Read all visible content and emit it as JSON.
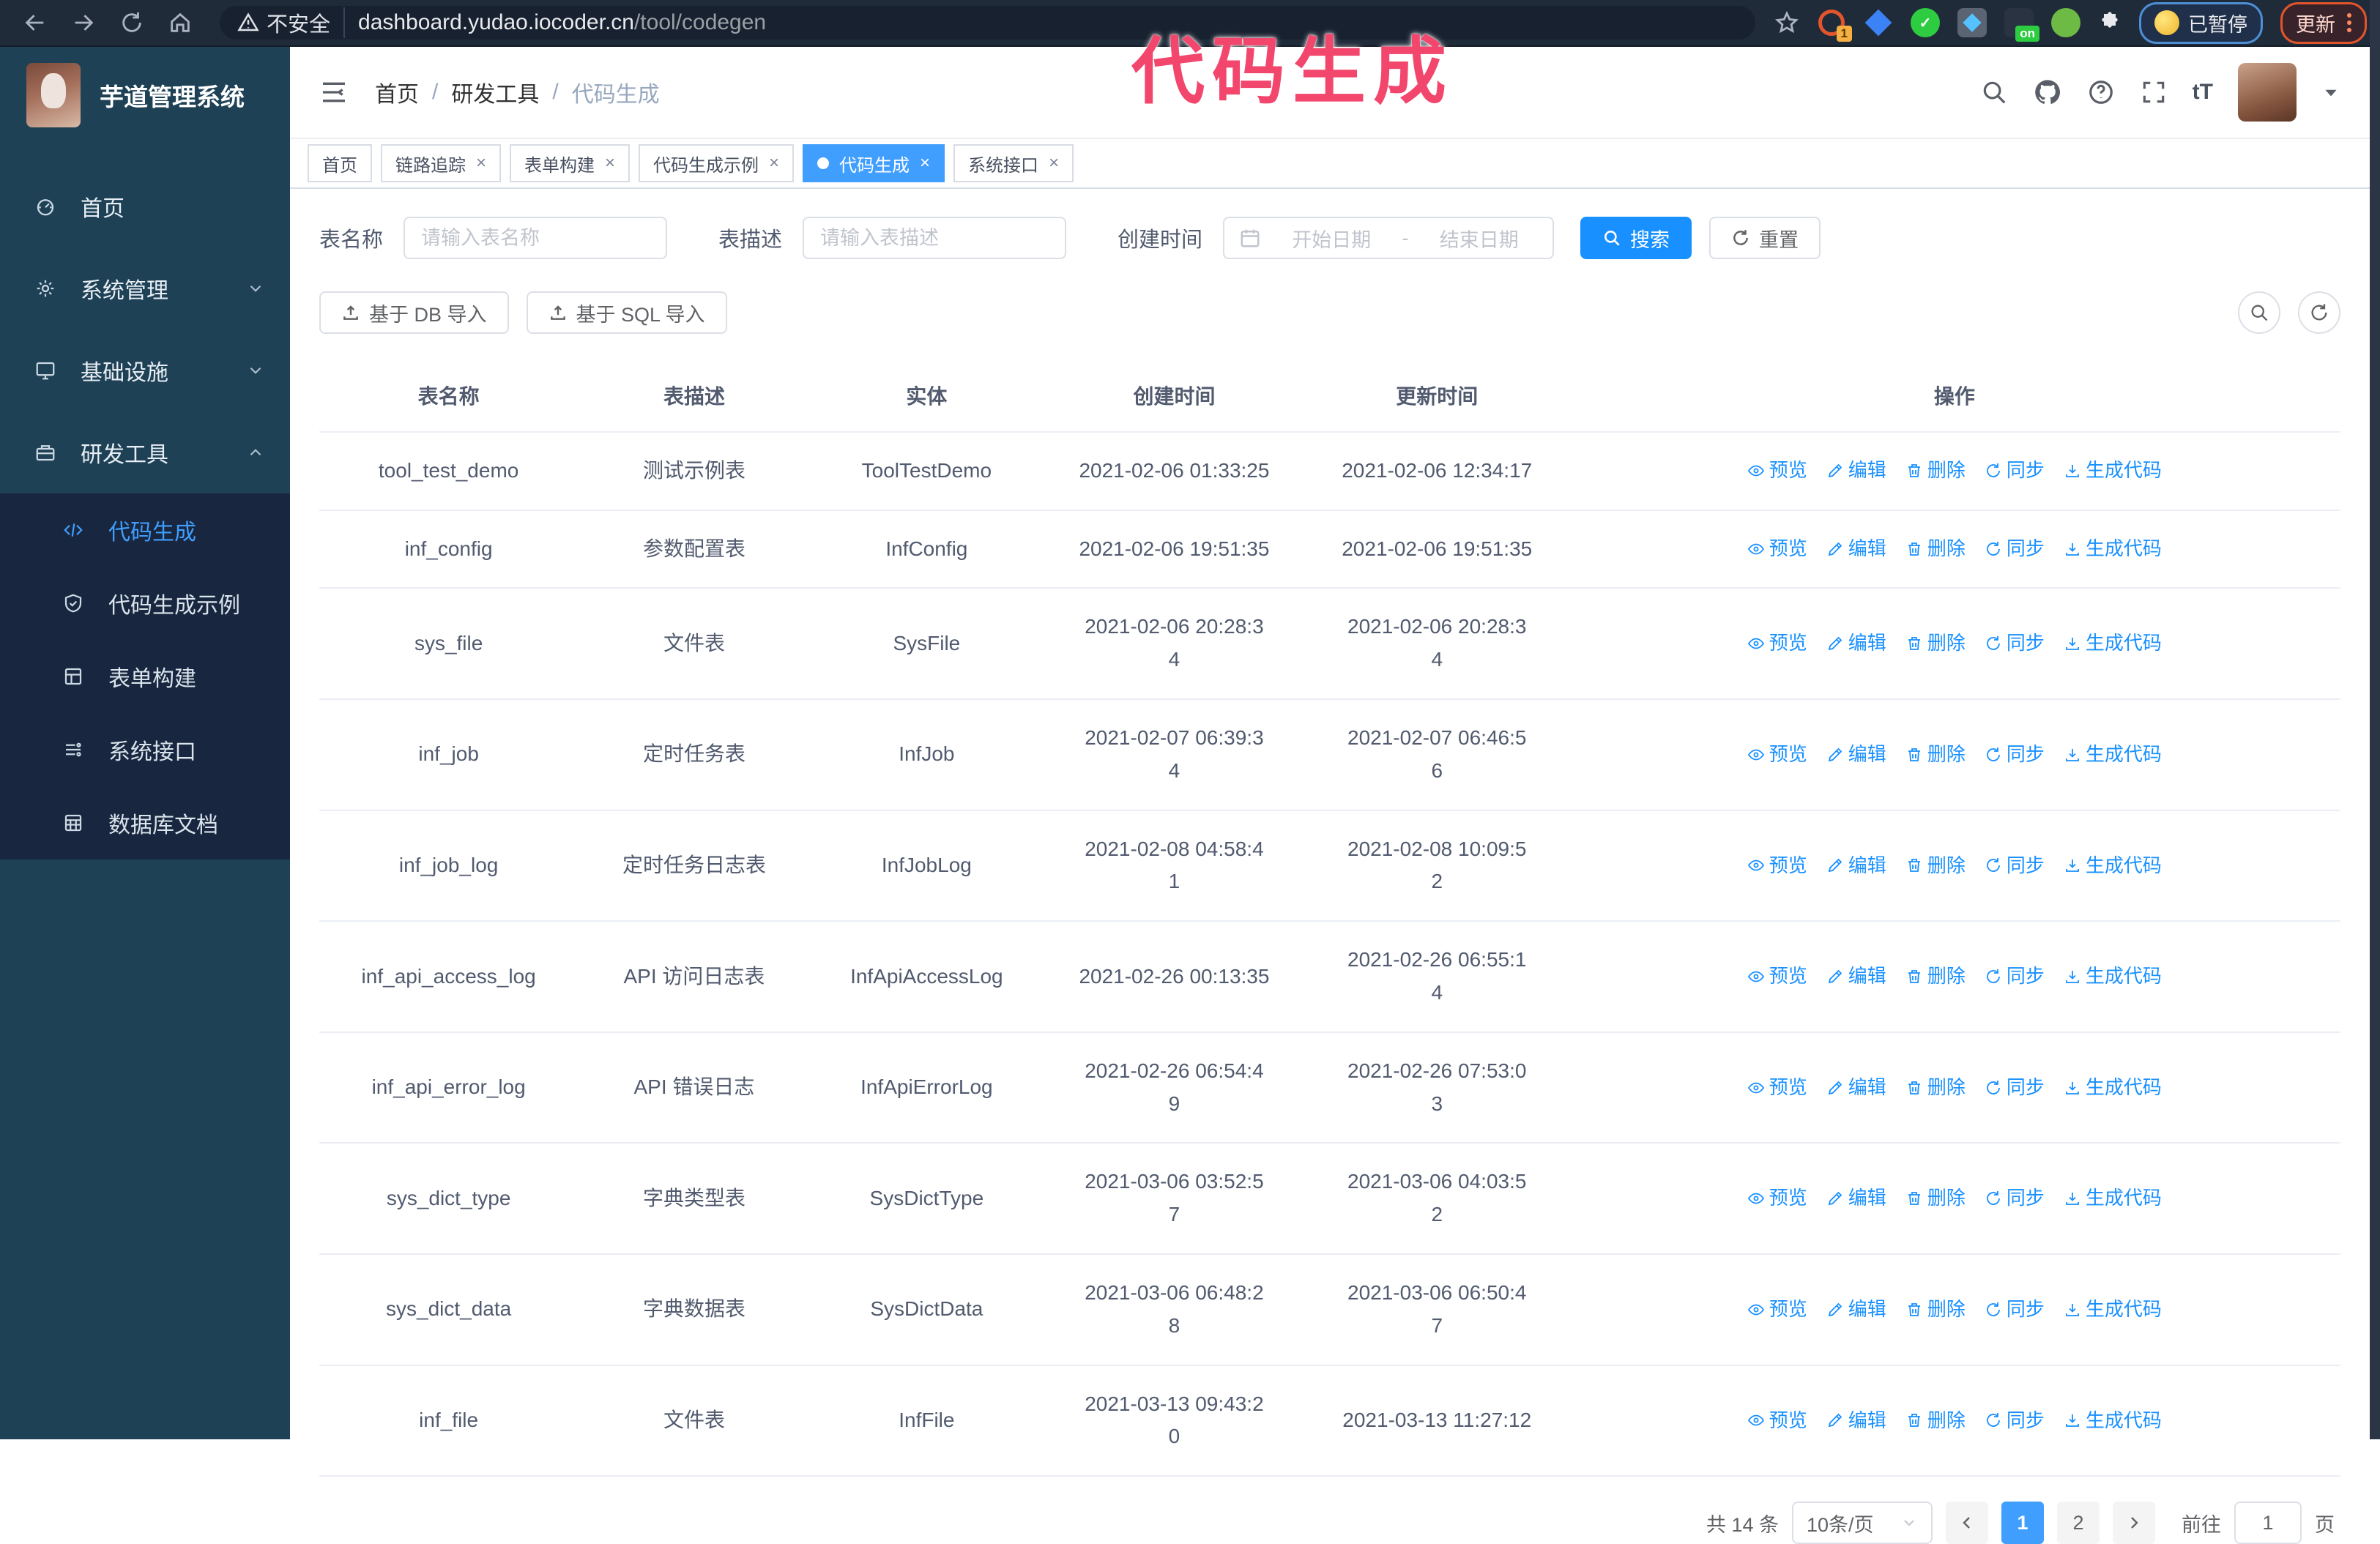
{
  "ui": {
    "close_glyph": "×",
    "breadcrumb_separator": "/"
  },
  "annotation": {
    "text": "代码生成",
    "color": "#f2466d"
  },
  "browser": {
    "security_label": "不安全",
    "url_domain": "dashboard.yudao.iocoder.cn",
    "url_path": "/tool/codegen",
    "extension_badge_1": "1",
    "extension_badge_on": "on",
    "paused_chip": "已暂停",
    "update_chip": "更新"
  },
  "sidebar": {
    "logo_title": "芋道管理系统",
    "items": [
      {
        "label": "首页",
        "icon": "dashboard-icon",
        "expandable": false,
        "expanded": false
      },
      {
        "label": "系统管理",
        "icon": "gear-icon",
        "expandable": true,
        "expanded": false
      },
      {
        "label": "基础设施",
        "icon": "monitor-icon",
        "expandable": true,
        "expanded": false
      },
      {
        "label": "研发工具",
        "icon": "toolbox-icon",
        "expandable": true,
        "expanded": true
      }
    ],
    "submenu": [
      {
        "label": "代码生成",
        "icon": "code-icon",
        "active": true
      },
      {
        "label": "代码生成示例",
        "icon": "shield-check-icon",
        "active": false
      },
      {
        "label": "表单构建",
        "icon": "form-icon",
        "active": false
      },
      {
        "label": "系统接口",
        "icon": "api-icon",
        "active": false
      },
      {
        "label": "数据库文档",
        "icon": "database-icon",
        "active": false
      }
    ]
  },
  "header": {
    "breadcrumb": [
      "首页",
      "研发工具",
      "代码生成"
    ]
  },
  "tabs": [
    {
      "label": "首页",
      "closable": false,
      "active": false
    },
    {
      "label": "链路追踪",
      "closable": true,
      "active": false
    },
    {
      "label": "表单构建",
      "closable": true,
      "active": false
    },
    {
      "label": "代码生成示例",
      "closable": true,
      "active": false
    },
    {
      "label": "代码生成",
      "closable": true,
      "active": true
    },
    {
      "label": "系统接口",
      "closable": true,
      "active": false
    }
  ],
  "search_form": {
    "name_label": "表名称",
    "name_placeholder": "请输入表名称",
    "desc_label": "表描述",
    "desc_placeholder": "请输入表描述",
    "time_label": "创建时间",
    "start_placeholder": "开始日期",
    "end_placeholder": "结束日期",
    "range_separator": "-",
    "search_button": "搜索",
    "reset_button": "重置"
  },
  "toolbar": {
    "import_db": "基于 DB 导入",
    "import_sql": "基于 SQL 导入"
  },
  "table": {
    "columns": [
      "表名称",
      "表描述",
      "实体",
      "创建时间",
      "更新时间",
      "操作"
    ],
    "actions": [
      "预览",
      "编辑",
      "删除",
      "同步",
      "生成代码"
    ],
    "rows": [
      {
        "name": "tool_test_demo",
        "desc": "测试示例表",
        "entity": "ToolTestDemo",
        "created": "2021-02-06 01:33:25",
        "updated": "2021-02-06 12:34:17"
      },
      {
        "name": "inf_config",
        "desc": "参数配置表",
        "entity": "InfConfig",
        "created": "2021-02-06 19:51:35",
        "updated": "2021-02-06 19:51:35"
      },
      {
        "name": "sys_file",
        "desc": "文件表",
        "entity": "SysFile",
        "created": "2021-02-06 20:28:3\n4",
        "updated": "2021-02-06 20:28:3\n4"
      },
      {
        "name": "inf_job",
        "desc": "定时任务表",
        "entity": "InfJob",
        "created": "2021-02-07 06:39:3\n4",
        "updated": "2021-02-07 06:46:5\n6"
      },
      {
        "name": "inf_job_log",
        "desc": "定时任务日志表",
        "entity": "InfJobLog",
        "created": "2021-02-08 04:58:4\n1",
        "updated": "2021-02-08 10:09:5\n2"
      },
      {
        "name": "inf_api_access_log",
        "desc": "API 访问日志表",
        "entity": "InfApiAccessLog",
        "created": "2021-02-26 00:13:35",
        "updated": "2021-02-26 06:55:1\n4"
      },
      {
        "name": "inf_api_error_log",
        "desc": "API 错误日志",
        "entity": "InfApiErrorLog",
        "created": "2021-02-26 06:54:4\n9",
        "updated": "2021-02-26 07:53:0\n3"
      },
      {
        "name": "sys_dict_type",
        "desc": "字典类型表",
        "entity": "SysDictType",
        "created": "2021-03-06 03:52:5\n7",
        "updated": "2021-03-06 04:03:5\n2"
      },
      {
        "name": "sys_dict_data",
        "desc": "字典数据表",
        "entity": "SysDictData",
        "created": "2021-03-06 06:48:2\n8",
        "updated": "2021-03-06 06:50:4\n7"
      },
      {
        "name": "inf_file",
        "desc": "文件表",
        "entity": "InfFile",
        "created": "2021-03-13 09:43:2\n0",
        "updated": "2021-03-13 11:27:12"
      }
    ]
  },
  "pagination": {
    "total_text": "共 14 条",
    "page_size": "10条/页",
    "pages": [
      "1",
      "2"
    ],
    "active_page": "1",
    "goto_label": "前往",
    "goto_value": "1",
    "page_suffix": "页"
  }
}
